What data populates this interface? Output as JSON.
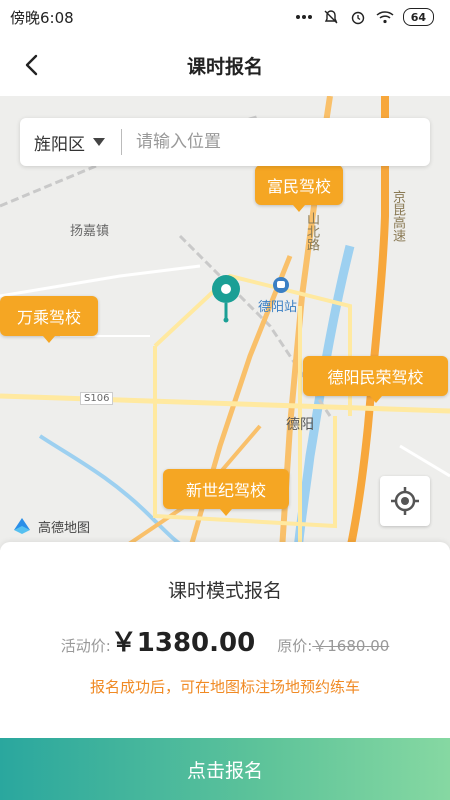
{
  "status_bar": {
    "time": "傍晚6:08",
    "battery": "64"
  },
  "header": {
    "title": "课时报名"
  },
  "search": {
    "district": "旌阳区",
    "placeholder": "请输入位置"
  },
  "map": {
    "labels": {
      "town": "扬嘉镇",
      "station": "德阳站",
      "city": "德阳",
      "road_shanbei": "山北路",
      "highway": "京昆高速",
      "route": "S106"
    },
    "schools": [
      "富民驾校",
      "万乘驾校",
      "德阳民荣驾校",
      "新世纪驾校"
    ],
    "logo": "高德地图"
  },
  "colors": {
    "accent_orange": "#f5a623",
    "cta_start": "#2aa79e",
    "cta_end": "#86d8a2",
    "pin": "#1a9f95"
  },
  "sheet": {
    "title": "课时模式报名",
    "activity_label": "活动价:",
    "activity_price": "￥1380.00",
    "original_label": "原价:",
    "original_price": "￥1680.00",
    "notice": "报名成功后，可在地图标注场地预约练车",
    "cta_label": "点击报名"
  }
}
